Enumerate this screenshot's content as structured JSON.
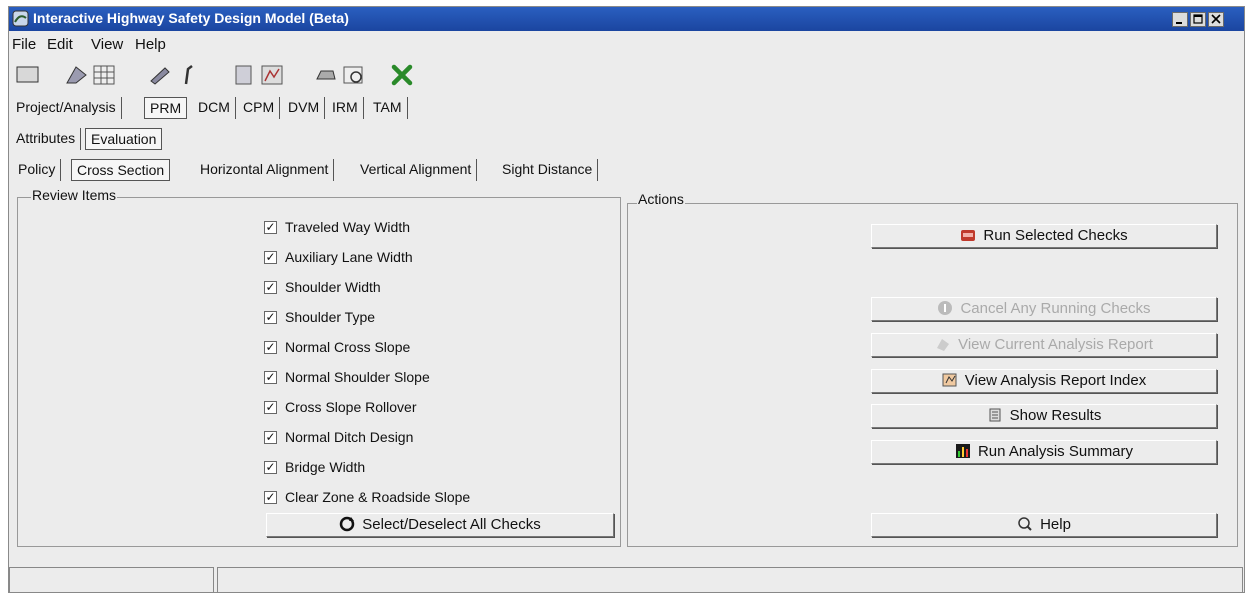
{
  "window": {
    "title": "Interactive Highway Safety Design Model (Beta)"
  },
  "menu": [
    "File",
    "Edit",
    "View",
    "Help"
  ],
  "toolbar_icons": [
    "new-icon",
    "open-road-icon",
    "table-icon",
    "edit-icon",
    "tool-icon",
    "report-icon",
    "chart-icon",
    "print-icon",
    "preview-icon",
    "excel-icon"
  ],
  "module_tabs": [
    "Project/Analysis",
    "PRM",
    "DCM",
    "CPM",
    "DVM",
    "IRM",
    "TAM"
  ],
  "sub_tabs": [
    "Attributes",
    "Evaluation"
  ],
  "section_tabs": [
    "Policy",
    "Cross Section",
    "Horizontal Alignment",
    "Vertical Alignment",
    "Sight Distance"
  ],
  "review": {
    "title": "Review Items",
    "items": [
      {
        "label": "Traveled Way Width",
        "checked": true
      },
      {
        "label": "Auxiliary Lane Width",
        "checked": true
      },
      {
        "label": "Shoulder Width",
        "checked": true
      },
      {
        "label": "Shoulder Type",
        "checked": true
      },
      {
        "label": "Normal Cross Slope",
        "checked": true
      },
      {
        "label": "Normal Shoulder Slope",
        "checked": true
      },
      {
        "label": "Cross Slope Rollover",
        "checked": true
      },
      {
        "label": "Normal Ditch Design",
        "checked": true
      },
      {
        "label": "Bridge Width",
        "checked": true
      },
      {
        "label": "Clear Zone & Roadside Slope",
        "checked": true
      }
    ],
    "select_all_label": "Select/Deselect All Checks"
  },
  "actions": {
    "title": "Actions",
    "run_selected": "Run Selected Checks",
    "cancel_running": "Cancel Any Running Checks",
    "view_current": "View Current Analysis Report",
    "view_index": "View Analysis Report Index",
    "show_results": "Show Results",
    "run_summary": "Run Analysis Summary",
    "help": "Help"
  }
}
